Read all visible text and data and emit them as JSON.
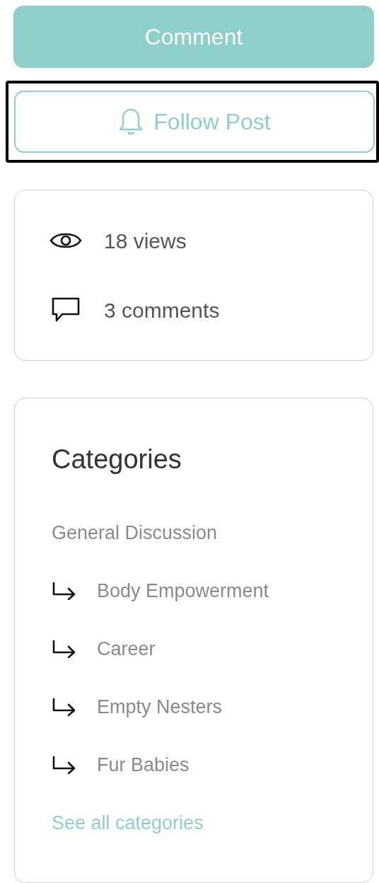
{
  "comment_button": {
    "label": "Comment"
  },
  "follow_button": {
    "label": "Follow Post",
    "focused": true
  },
  "stats": [
    {
      "kind": "views",
      "text": "18 views"
    },
    {
      "kind": "comments",
      "text": "3 comments"
    }
  ],
  "categories": {
    "title": "Categories",
    "items": [
      {
        "label": "General Discussion",
        "children": [
          {
            "label": "Body Empowerment"
          },
          {
            "label": "Career"
          },
          {
            "label": "Empty Nesters"
          },
          {
            "label": "Fur Babies"
          }
        ]
      }
    ],
    "see_all": "See all categories"
  }
}
